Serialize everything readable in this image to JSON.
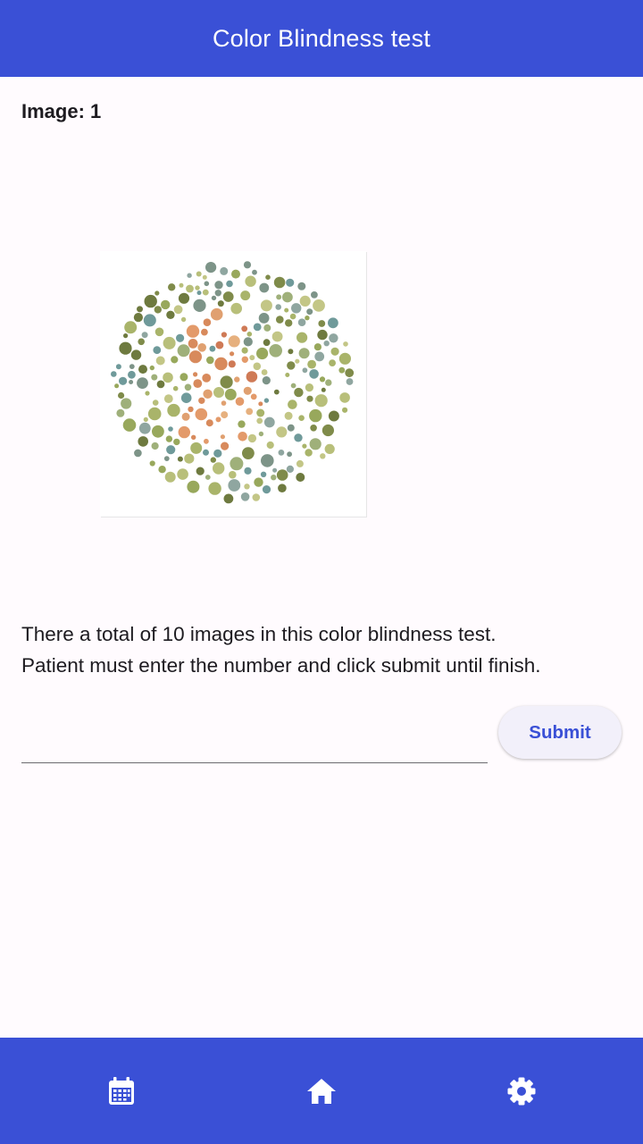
{
  "app_bar": {
    "title": "Color Blindness test"
  },
  "test": {
    "image_label": "Image: 1",
    "plate_icon": "ishihara-plate-image",
    "instructions_line1": "There a total of 10 images in this color blindness test.",
    "instructions_line2": "Patient must enter the number and click submit until finish."
  },
  "answer_input": {
    "value": "",
    "placeholder": ""
  },
  "submit_button": {
    "label": "Submit"
  },
  "bottom_nav": {
    "items": [
      {
        "icon": "calendar-icon"
      },
      {
        "icon": "home-icon"
      },
      {
        "icon": "gear-icon"
      }
    ]
  },
  "colors": {
    "primary": "#3a50d6",
    "background": "#fffbfe",
    "button_bg": "#f2f0fa",
    "text": "#1d1b20"
  }
}
